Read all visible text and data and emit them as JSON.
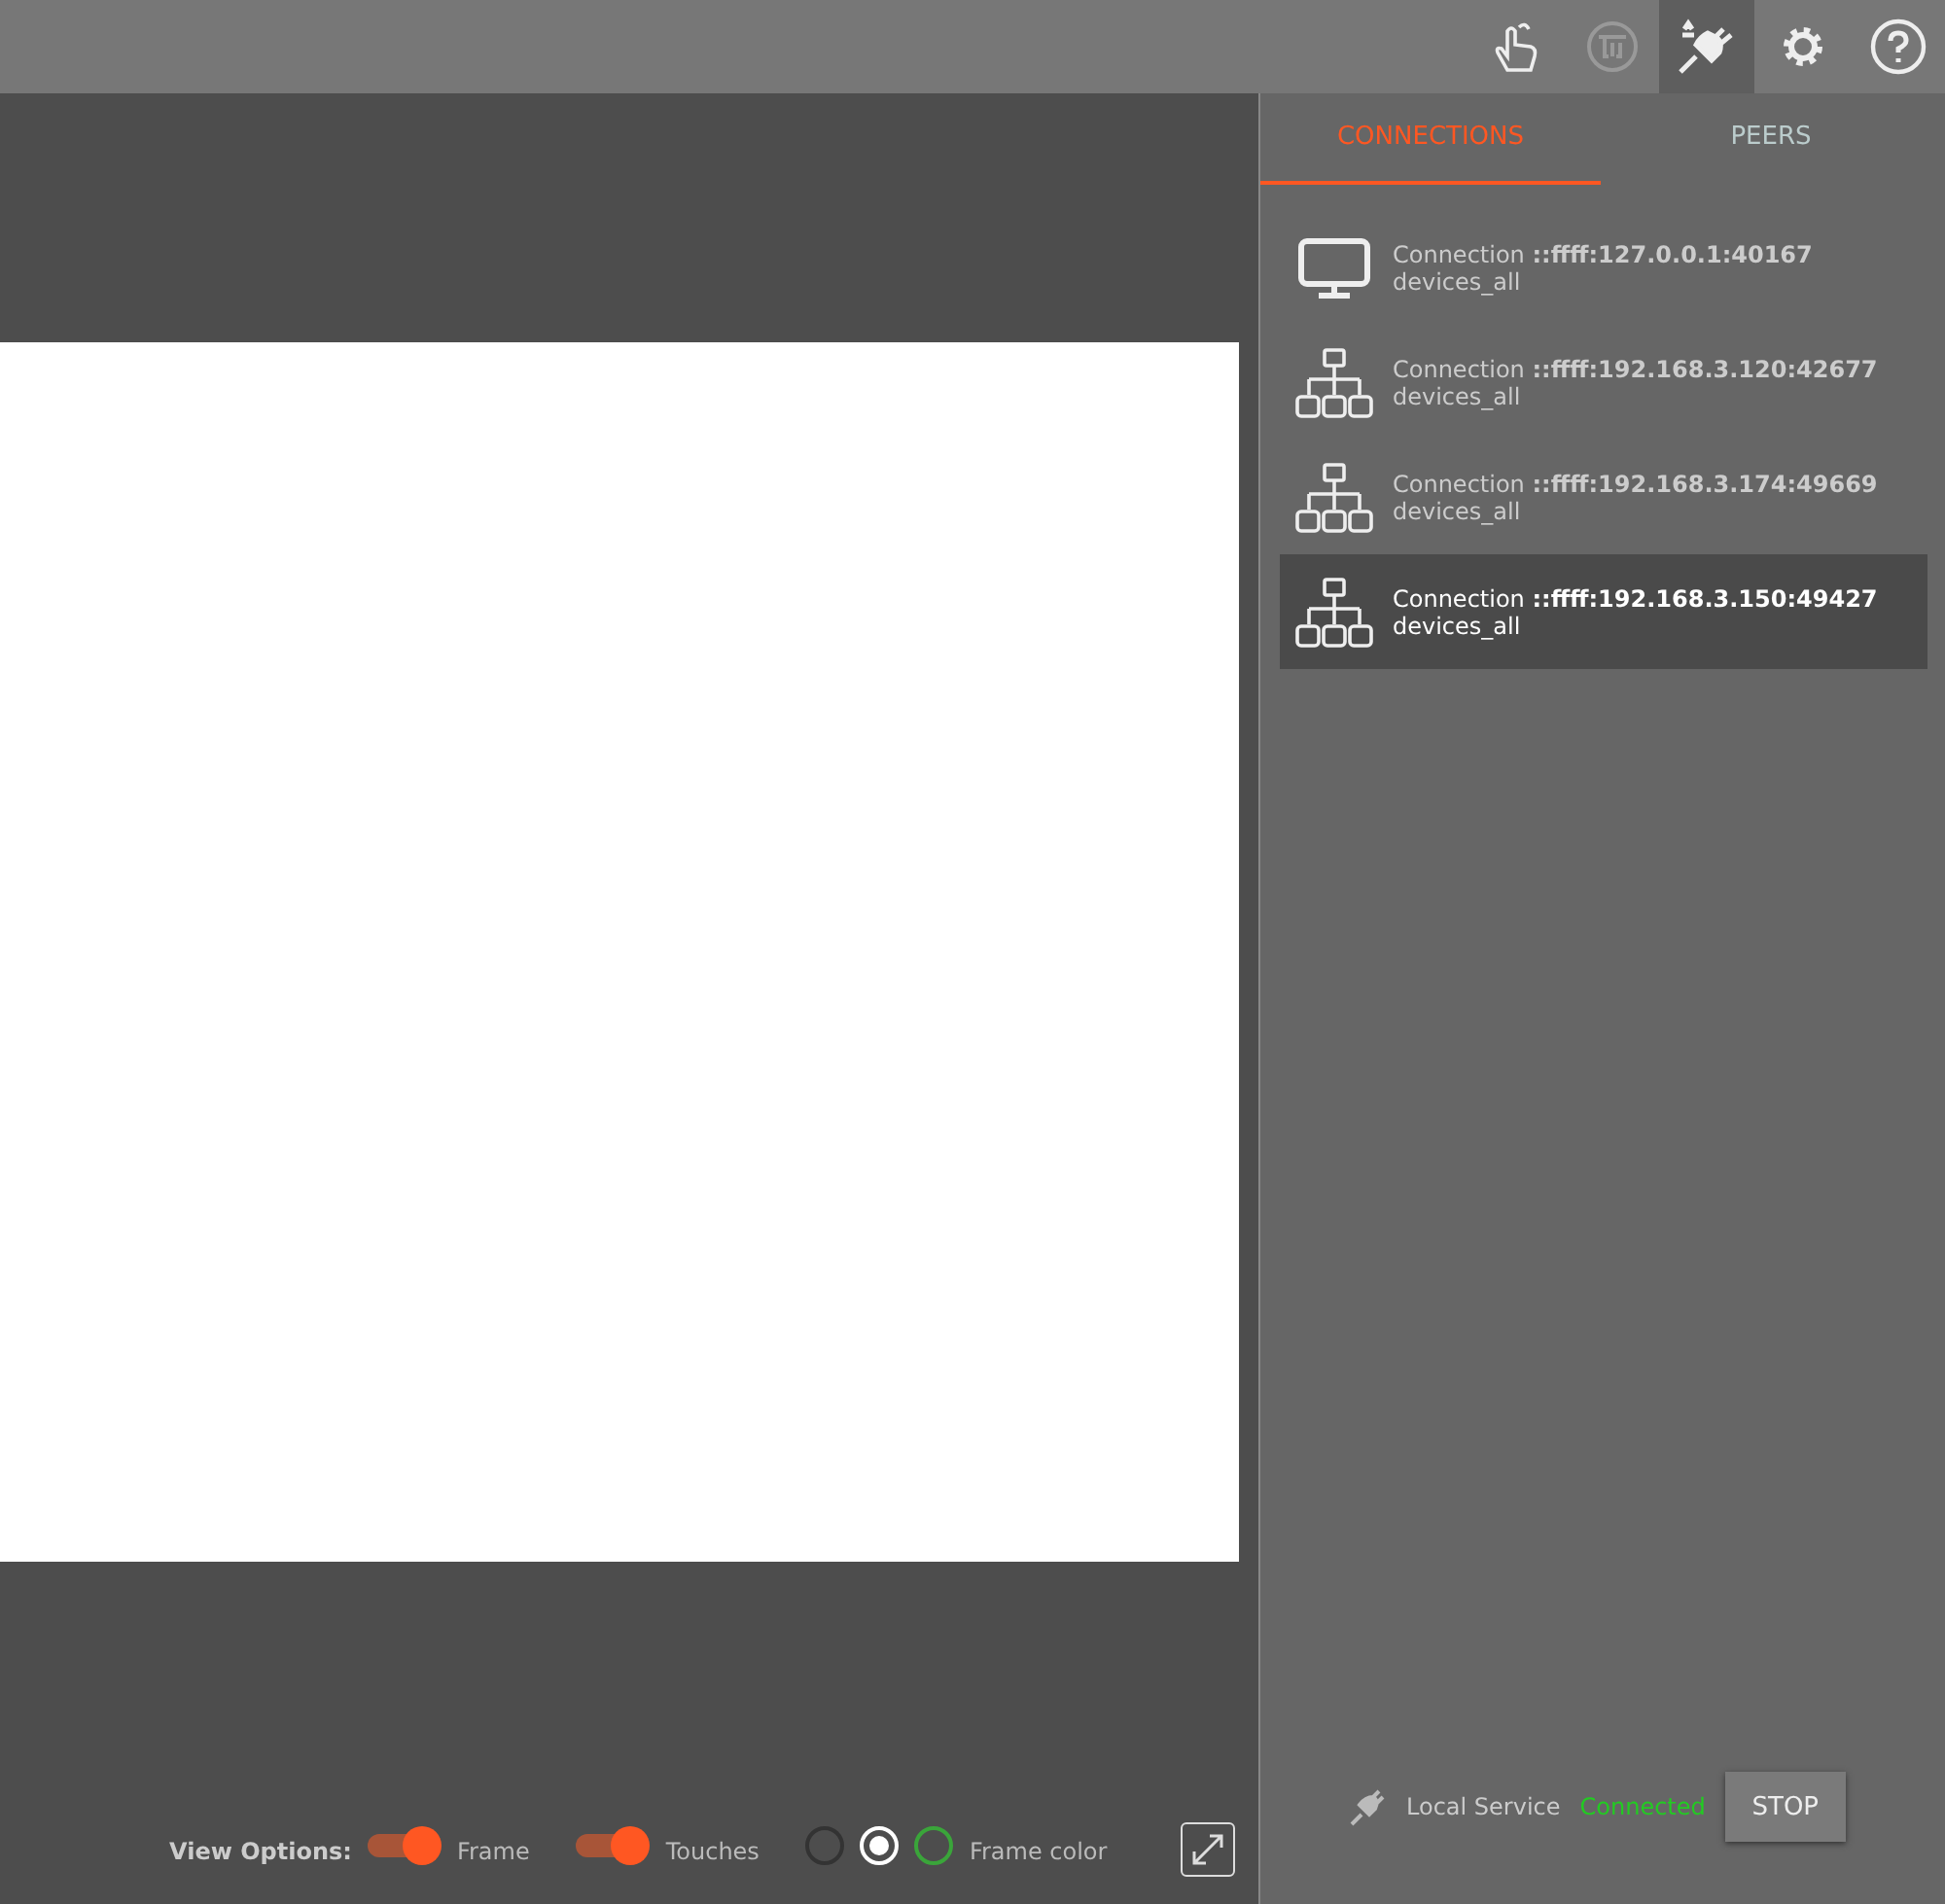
{
  "toolbar": [
    {
      "kind": "hand",
      "selected": false
    },
    {
      "kind": "tui",
      "selected": false
    },
    {
      "kind": "plug",
      "selected": true
    },
    {
      "kind": "gear",
      "selected": false
    },
    {
      "kind": "help",
      "selected": false
    }
  ],
  "tabs": [
    {
      "label": "CONNECTIONS",
      "selected": true
    },
    {
      "label": "PEERS",
      "selected": false
    }
  ],
  "connections": [
    {
      "kind": "monitor",
      "title": "Connection **::ffff:127.0.0.1:40167**",
      "group": "devices_all",
      "selected": false
    },
    {
      "kind": "network",
      "title": "Connection **::ffff:192.168.3.120:42677**",
      "group": "devices_all",
      "selected": false
    },
    {
      "kind": "network",
      "title": "Connection **::ffff:192.168.3.174:49669**",
      "group": "devices_all",
      "selected": false
    },
    {
      "kind": "network",
      "title": "Connection **::ffff:192.168.3.150:49427**",
      "group": "devices_all",
      "selected": true
    }
  ],
  "service": {
    "label": "Local Service",
    "status": "Connected",
    "button": "STOP"
  },
  "view_options": {
    "label": "View Options:",
    "toggles": [
      {
        "label": "Frame",
        "on": true
      },
      {
        "label": "Touches",
        "on": true
      }
    ],
    "frame_colors": [
      {
        "color": "#333333",
        "selected": false
      },
      {
        "color": "#ffffff",
        "selected": true
      },
      {
        "color": "#3aa53a",
        "selected": false
      }
    ],
    "frame_color_label": "Frame color"
  }
}
